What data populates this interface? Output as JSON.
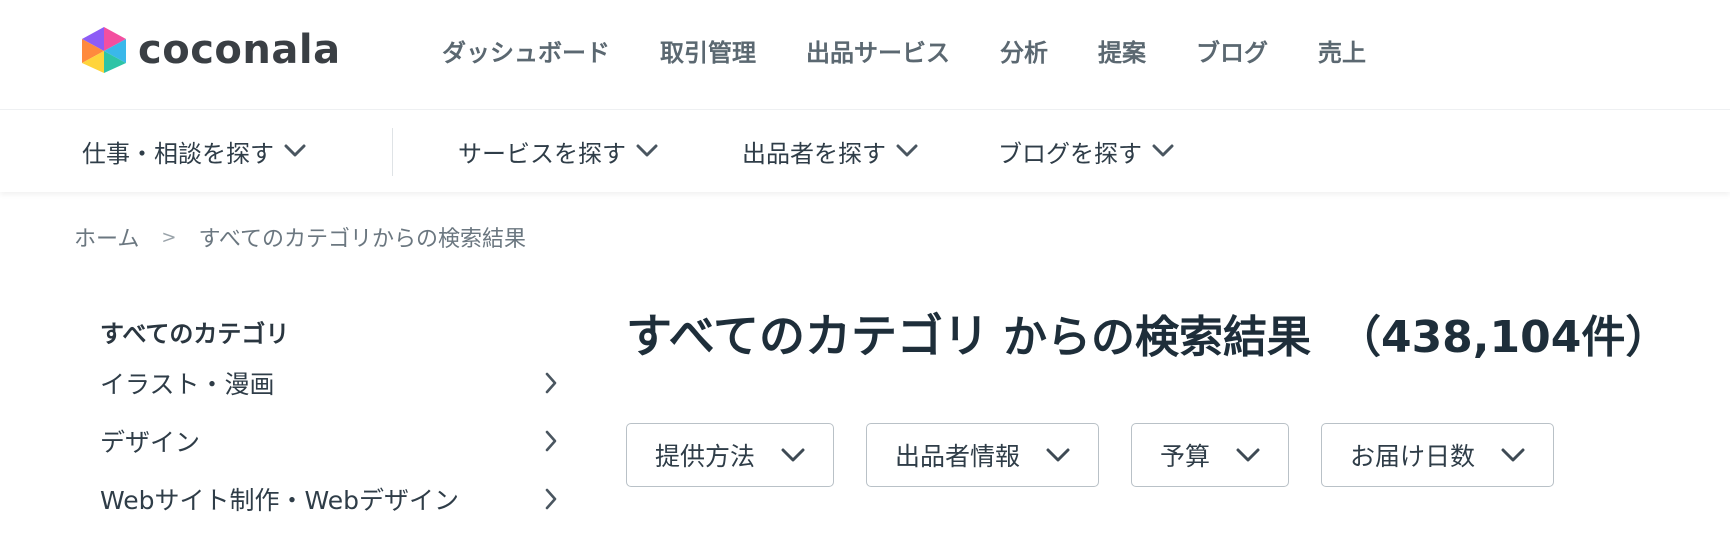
{
  "brand": {
    "name": "coconala",
    "colors": {
      "pink": "#f34fa0",
      "purple": "#8d5cf6",
      "cyan": "#3ab8ea",
      "yellow": "#ffd43b"
    }
  },
  "top_nav": {
    "items": [
      {
        "label": "ダッシュボード"
      },
      {
        "label": "取引管理"
      },
      {
        "label": "出品サービス"
      },
      {
        "label": "分析"
      },
      {
        "label": "提案"
      },
      {
        "label": "ブログ"
      },
      {
        "label": "売上"
      }
    ]
  },
  "sub_nav": {
    "items": [
      {
        "label": "仕事・相談を探す",
        "icon": "chevron-down-icon"
      },
      {
        "label": "サービスを探す",
        "icon": "chevron-down-icon"
      },
      {
        "label": "出品者を探す",
        "icon": "chevron-down-icon"
      },
      {
        "label": "ブログを探す",
        "icon": "chevron-down-icon"
      }
    ]
  },
  "breadcrumb": {
    "home": "ホーム",
    "separator": ">",
    "current": "すべてのカテゴリからの検索結果"
  },
  "sidebar": {
    "heading": "すべてのカテゴリ",
    "items": [
      {
        "label": "イラスト・漫画",
        "icon": "chevron-right-icon"
      },
      {
        "label": "デザイン",
        "icon": "chevron-right-icon"
      },
      {
        "label": "Webサイト制作・Webデザイン",
        "icon": "chevron-right-icon"
      }
    ]
  },
  "results": {
    "category": "すべてのカテゴリ",
    "suffix": "からの検索結果",
    "count": "（438,104件）"
  },
  "filters": {
    "items": [
      {
        "label": "提供方法",
        "icon": "chevron-down-icon"
      },
      {
        "label": "出品者情報",
        "icon": "chevron-down-icon"
      },
      {
        "label": "予算",
        "icon": "chevron-down-icon"
      },
      {
        "label": "お届け日数",
        "icon": "chevron-down-icon"
      }
    ]
  }
}
